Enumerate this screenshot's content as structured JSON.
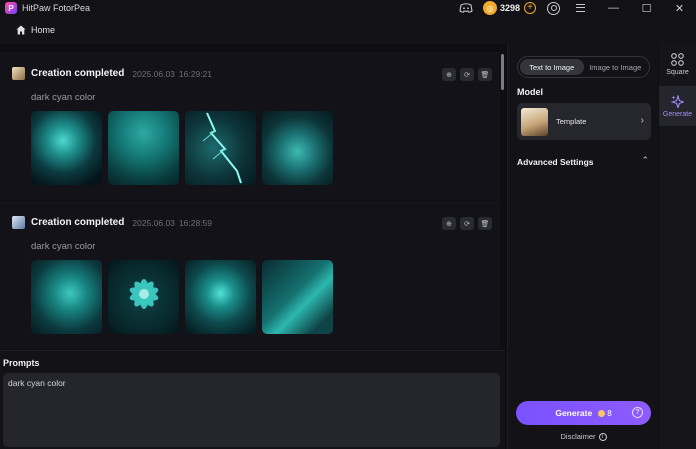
{
  "app": {
    "title": "HitPaw FotorPea",
    "credits": "3298"
  },
  "nav": {
    "home_label": "Home"
  },
  "feed": {
    "items": [
      {
        "title": "Creation completed",
        "date": "2025.06.03",
        "time": "16:29:21",
        "prompt": "dark cyan color"
      },
      {
        "title": "Creation completed",
        "date": "2025.06.03",
        "time": "16:28:59",
        "prompt": "dark cyan color"
      }
    ]
  },
  "prompts": {
    "title": "Prompts",
    "value": "dark cyan color"
  },
  "settings": {
    "modes": [
      "Text to Image",
      "Image to Image"
    ],
    "active_mode": "Text to Image",
    "model_label": "Model",
    "model_name": "Template",
    "advanced_label": "Advanced Settings",
    "generate_label": "Generate",
    "generate_cost": "8",
    "disclaimer": "Disclaimer"
  },
  "rail": {
    "square_label": "Square",
    "generate_label": "Generate"
  },
  "colors": {
    "accent": "#7a52ff",
    "coin": "#f0a92a",
    "background": "#0d0d12"
  }
}
